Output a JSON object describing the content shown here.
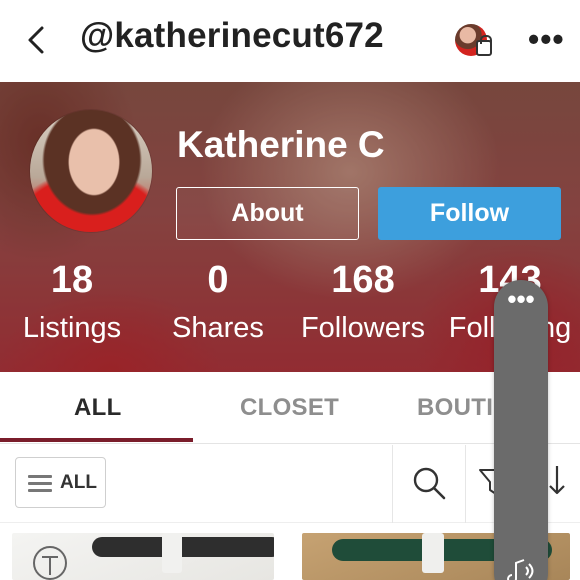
{
  "header": {
    "handle": "@katherinecut672",
    "back_icon": "chevron-left-icon",
    "more_icon": "more-horizontal-icon",
    "more_label": "•••"
  },
  "profile": {
    "name": "Katherine C",
    "about_label": "About",
    "follow_label": "Follow",
    "stats": [
      {
        "value": "18",
        "label": "Listings"
      },
      {
        "value": "0",
        "label": "Shares"
      },
      {
        "value": "168",
        "label": "Followers"
      },
      {
        "value": "143",
        "label": "Following"
      }
    ]
  },
  "tabs": [
    {
      "label": "ALL",
      "active": true
    },
    {
      "label": "CLOSET",
      "active": false
    },
    {
      "label": "BOUTIQUE",
      "active": false
    }
  ],
  "filter": {
    "all_label": "ALL",
    "menu_icon": "hamburger-icon",
    "search_icon": "search-icon",
    "filter_icon": "filter-icon",
    "sort_icon": "sort-icon"
  },
  "overlay": {
    "dots_label": "•••",
    "audio_icon": "audio-icon"
  },
  "colors": {
    "follow_button": "#3d9fdd",
    "active_tab_underline": "#7a1d2b",
    "pill_overlay": "#6b6b6b"
  }
}
